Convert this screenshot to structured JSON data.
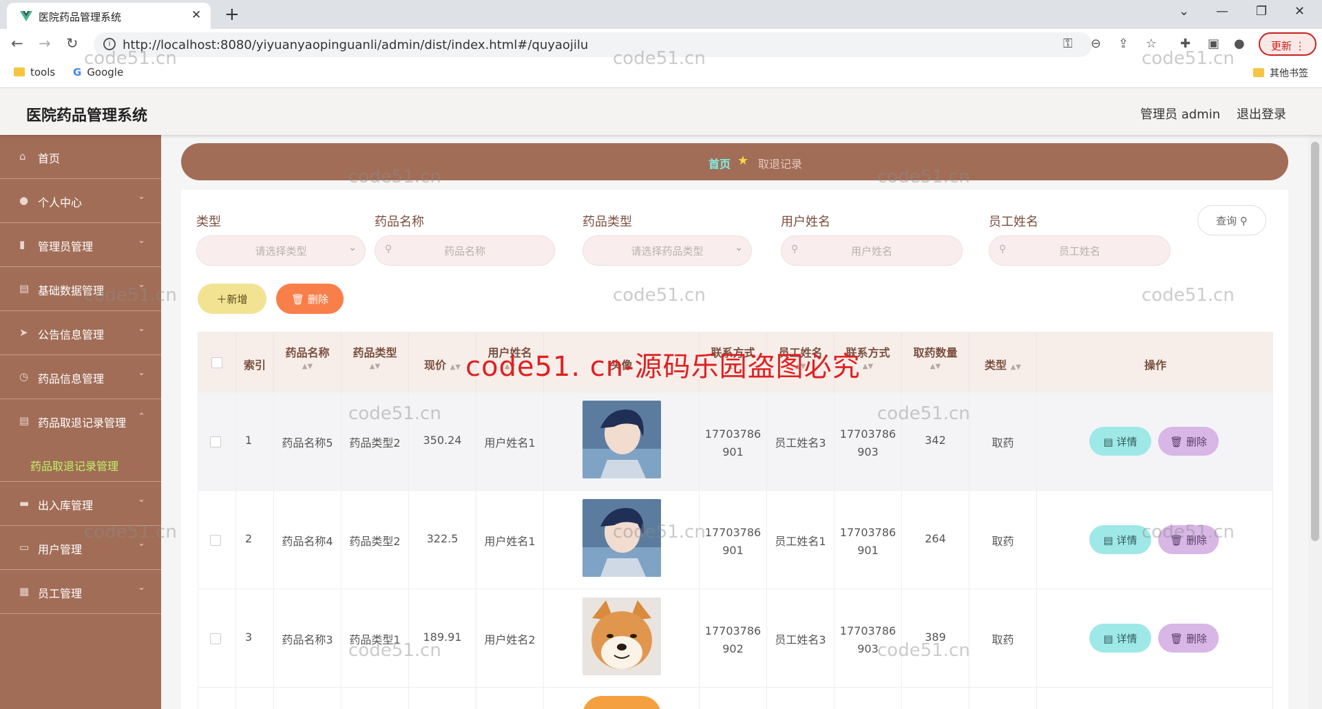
{
  "browser": {
    "tab_title": "医院药品管理系统",
    "url": "http://localhost:8080/yiyuanyaopinguanli/admin/dist/index.html#/quyaojilu",
    "update_label": "更新",
    "bookmarks": [
      "tools",
      "Google"
    ],
    "other_bookmarks": "其他书签"
  },
  "header": {
    "app_title": "医院药品管理系统",
    "user": "管理员 admin",
    "logout": "退出登录"
  },
  "sidebar": {
    "items": [
      {
        "label": "首页",
        "icon": "home-icon"
      },
      {
        "label": "个人中心",
        "icon": "user-icon"
      },
      {
        "label": "管理员管理",
        "icon": "bar-chart-icon"
      },
      {
        "label": "基础数据管理",
        "icon": "document-icon"
      },
      {
        "label": "公告信息管理",
        "icon": "send-icon"
      },
      {
        "label": "药品信息管理",
        "icon": "clock-icon"
      },
      {
        "label": "药品取退记录管理",
        "icon": "document-icon"
      },
      {
        "label": "出入库管理",
        "icon": "book-icon"
      },
      {
        "label": "用户管理",
        "icon": "chat-icon"
      },
      {
        "label": "员工管理",
        "icon": "grid-icon"
      }
    ],
    "active_submenu": "药品取退记录管理"
  },
  "breadcrumb": {
    "home": "首页",
    "current": "取退记录"
  },
  "filters": {
    "type_label": "类型",
    "type_placeholder": "请选择类型",
    "drug_name_label": "药品名称",
    "drug_name_placeholder": "药品名称",
    "drug_type_label": "药品类型",
    "drug_type_placeholder": "请选择药品类型",
    "user_name_label": "用户姓名",
    "user_name_placeholder": "用户姓名",
    "staff_name_label": "员工姓名",
    "staff_name_placeholder": "员工姓名",
    "query_label": "查询"
  },
  "actions": {
    "add_label": "新增",
    "delete_label": "删除"
  },
  "table": {
    "headers": {
      "index": "索引",
      "drug_name": "药品名称",
      "drug_type": "药品类型",
      "price": "现价",
      "user_name": "用户姓名",
      "avatar": "头像",
      "contact": "联系方式",
      "staff_name": "员工姓名",
      "staff_contact": "联系方式",
      "quantity": "取药数量",
      "type": "类型",
      "ops": "操作"
    },
    "rows": [
      {
        "index": "1",
        "drug_name": "药品名称5",
        "drug_type": "药品类型2",
        "price": "350.24",
        "user_name": "用户姓名1",
        "photo": "anime-boy",
        "contact_a": "17703786",
        "contact_b": "901",
        "staff_name": "员工姓名3",
        "staff_contact_a": "17703786",
        "staff_contact_b": "903",
        "quantity": "342",
        "type": "取药"
      },
      {
        "index": "2",
        "drug_name": "药品名称4",
        "drug_type": "药品类型2",
        "price": "322.5",
        "user_name": "用户姓名1",
        "photo": "anime-boy",
        "contact_a": "17703786",
        "contact_b": "901",
        "staff_name": "员工姓名1",
        "staff_contact_a": "17703786",
        "staff_contact_b": "901",
        "quantity": "264",
        "type": "取药"
      },
      {
        "index": "3",
        "drug_name": "药品名称3",
        "drug_type": "药品类型1",
        "price": "189.91",
        "user_name": "用户姓名2",
        "photo": "shiba-dog",
        "contact_a": "17703786",
        "contact_b": "902",
        "staff_name": "员工姓名3",
        "staff_contact_a": "17703786",
        "staff_contact_b": "903",
        "quantity": "389",
        "type": "取药"
      }
    ],
    "detail_label": "详情",
    "row_delete_label": "删除"
  },
  "watermark": "code51.cn",
  "banner": "code51. cn-源码乐园盗图必究",
  "colors": {
    "sidebar": "#a26d57",
    "accent_cyan": "#9fe8e8",
    "accent_purple": "#d8b6e6",
    "add_yellow": "#f2e393",
    "delete_orange": "#f97f4a"
  }
}
